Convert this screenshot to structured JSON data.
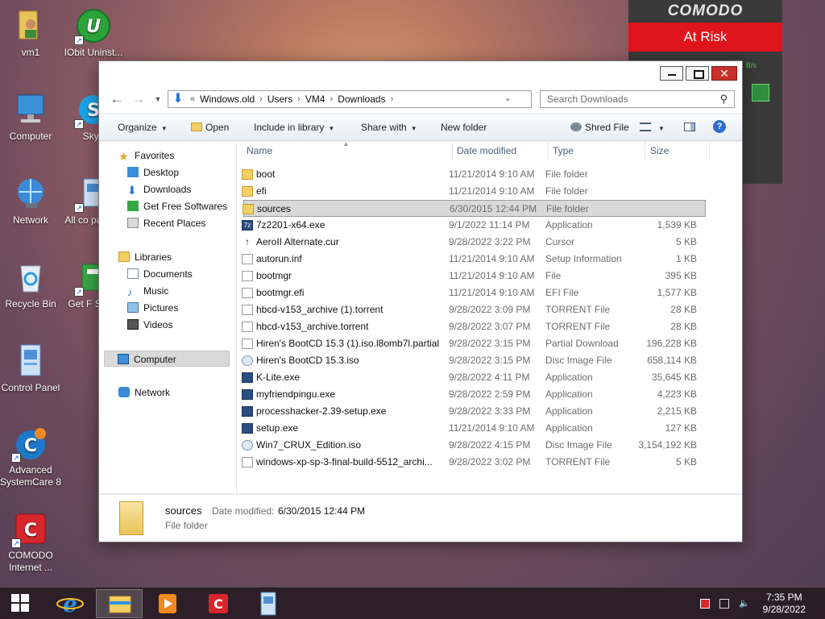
{
  "desktop": {
    "icons": [
      {
        "label": "vm1"
      },
      {
        "label": "IObit Uninst..."
      },
      {
        "label": "Computer"
      },
      {
        "label": "Skyp"
      },
      {
        "label": "Network"
      },
      {
        "label": "All co panel it"
      },
      {
        "label": "Recycle Bin"
      },
      {
        "label": "Get F Softw"
      },
      {
        "label": "Control Panel"
      },
      {
        "label": "Advanced SystemCare 8"
      },
      {
        "label": "COMODO Internet ..."
      }
    ]
  },
  "comodo": {
    "brand": "COMODO",
    "status": "At Risk",
    "speed": "B/s",
    "status_color": "#e0141c"
  },
  "window": {
    "address": {
      "prefix": "«",
      "crumbs": [
        "Windows.old",
        "Users",
        "VM4",
        "Downloads"
      ]
    },
    "search_placeholder": "Search Downloads",
    "toolbar": {
      "organize": "Organize",
      "open": "Open",
      "include_in_library": "Include in library",
      "share_with": "Share with",
      "new_folder": "New folder",
      "shred_file": "Shred File"
    },
    "nav": {
      "favorites": "Favorites",
      "desktop": "Desktop",
      "downloads": "Downloads",
      "get_free_softwares": "Get Free Softwares",
      "recent_places": "Recent Places",
      "libraries": "Libraries",
      "documents": "Documents",
      "music": "Music",
      "pictures": "Pictures",
      "videos": "Videos",
      "computer": "Computer",
      "network": "Network"
    },
    "columns": {
      "name": "Name",
      "date": "Date modified",
      "type": "Type",
      "size": "Size"
    },
    "files": [
      {
        "name": "boot",
        "date": "11/21/2014 9:10 AM",
        "type": "File folder",
        "size": "",
        "icon": "folder"
      },
      {
        "name": "efi",
        "date": "11/21/2014 9:10 AM",
        "type": "File folder",
        "size": "",
        "icon": "folder"
      },
      {
        "name": "sources",
        "date": "6/30/2015 12:44 PM",
        "type": "File folder",
        "size": "",
        "icon": "folder"
      },
      {
        "name": "7z2201-x64.exe",
        "date": "9/1/2022 11:14 PM",
        "type": "Application",
        "size": "1,539 KB",
        "icon": "7z"
      },
      {
        "name": "AeroII Alternate.cur",
        "date": "9/28/2022 3:22 PM",
        "type": "Cursor",
        "size": "5 KB",
        "icon": "cursor"
      },
      {
        "name": "autorun.inf",
        "date": "11/21/2014 9:10 AM",
        "type": "Setup Information",
        "size": "1 KB",
        "icon": "inf"
      },
      {
        "name": "bootmgr",
        "date": "11/21/2014 9:10 AM",
        "type": "File",
        "size": "395 KB",
        "icon": "doc"
      },
      {
        "name": "bootmgr.efi",
        "date": "11/21/2014 9:10 AM",
        "type": "EFI File",
        "size": "1,577 KB",
        "icon": "doc"
      },
      {
        "name": "hbcd-v153_archive (1).torrent",
        "date": "9/28/2022 3:09 PM",
        "type": "TORRENT File",
        "size": "28 KB",
        "icon": "doc"
      },
      {
        "name": "hbcd-v153_archive.torrent",
        "date": "9/28/2022 3:07 PM",
        "type": "TORRENT File",
        "size": "28 KB",
        "icon": "doc"
      },
      {
        "name": "Hiren's BootCD 15.3 (1).iso.l8omb7l.partial",
        "date": "9/28/2022 3:15 PM",
        "type": "Partial Download",
        "size": "196,228 KB",
        "icon": "partial"
      },
      {
        "name": "Hiren's BootCD 15.3.iso",
        "date": "9/28/2022 3:15 PM",
        "type": "Disc Image File",
        "size": "658,114 KB",
        "icon": "iso"
      },
      {
        "name": "K-Lite.exe",
        "date": "9/28/2022 4:11 PM",
        "type": "Application",
        "size": "35,645 KB",
        "icon": "app"
      },
      {
        "name": "myfriendpingu.exe",
        "date": "9/28/2022 2:59 PM",
        "type": "Application",
        "size": "4,223 KB",
        "icon": "app"
      },
      {
        "name": "processhacker-2.39-setup.exe",
        "date": "9/28/2022 3:33 PM",
        "type": "Application",
        "size": "2,215 KB",
        "icon": "app"
      },
      {
        "name": "setup.exe",
        "date": "11/21/2014 9:10 AM",
        "type": "Application",
        "size": "127 KB",
        "icon": "app"
      },
      {
        "name": "Win7_CRUX_Edition.iso",
        "date": "9/28/2022 4:15 PM",
        "type": "Disc Image File",
        "size": "3,154,192 KB",
        "icon": "iso"
      },
      {
        "name": "windows-xp-sp-3-final-build-5512_archi...",
        "date": "9/28/2022 3:02 PM",
        "type": "TORRENT File",
        "size": "5 KB",
        "icon": "doc"
      }
    ],
    "selected_index": 2,
    "details": {
      "name": "sources",
      "modified_label": "Date modified:",
      "modified_value": "6/30/2015 12:44 PM",
      "type": "File folder"
    }
  },
  "taskbar": {
    "time": "7:35 PM",
    "date": "9/28/2022"
  }
}
